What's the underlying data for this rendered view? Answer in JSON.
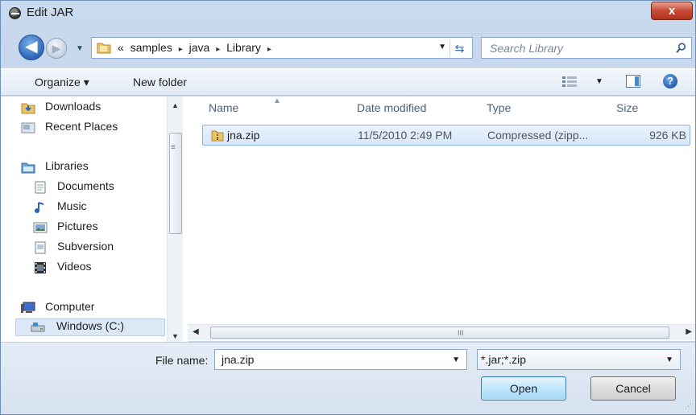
{
  "window": {
    "title": "Edit JAR",
    "close_label": "x"
  },
  "nav": {
    "back_glyph": "◀",
    "forward_glyph": "▶"
  },
  "address": {
    "overflow": "«",
    "crumbs": [
      "samples",
      "java",
      "Library"
    ],
    "separator": "▸"
  },
  "search": {
    "placeholder": "Search Library"
  },
  "toolbar": {
    "organize_label": "Organize ▾",
    "new_folder_label": "New folder",
    "help_label": "?"
  },
  "sidebar": {
    "favorites": [
      {
        "label": "Downloads",
        "icon": "downloads-icon"
      },
      {
        "label": "Recent Places",
        "icon": "recent-places-icon"
      }
    ],
    "libraries": {
      "label": "Libraries",
      "items": [
        {
          "label": "Documents",
          "icon": "documents-icon"
        },
        {
          "label": "Music",
          "icon": "music-icon"
        },
        {
          "label": "Pictures",
          "icon": "pictures-icon"
        },
        {
          "label": "Subversion",
          "icon": "subversion-icon"
        },
        {
          "label": "Videos",
          "icon": "videos-icon"
        }
      ]
    },
    "computer": {
      "label": "Computer",
      "items": [
        {
          "label": "Windows (C:)",
          "icon": "drive-icon"
        }
      ]
    }
  },
  "files": {
    "columns": [
      "Name",
      "Date modified",
      "Type",
      "Size"
    ],
    "rows": [
      {
        "name": "jna.zip",
        "date_modified": "11/5/2010 2:49 PM",
        "type": "Compressed (zipp...",
        "size": "926 KB"
      }
    ]
  },
  "footer": {
    "file_name_label": "File name:",
    "file_name_value": "jna.zip",
    "filter_value": "*.jar;*.zip",
    "open_label": "Open",
    "cancel_label": "Cancel",
    "hscroll_grip": "III"
  },
  "colors": {
    "selection": "#d6e7fa",
    "accent": "#3c7fb1",
    "close": "#c64a34"
  }
}
